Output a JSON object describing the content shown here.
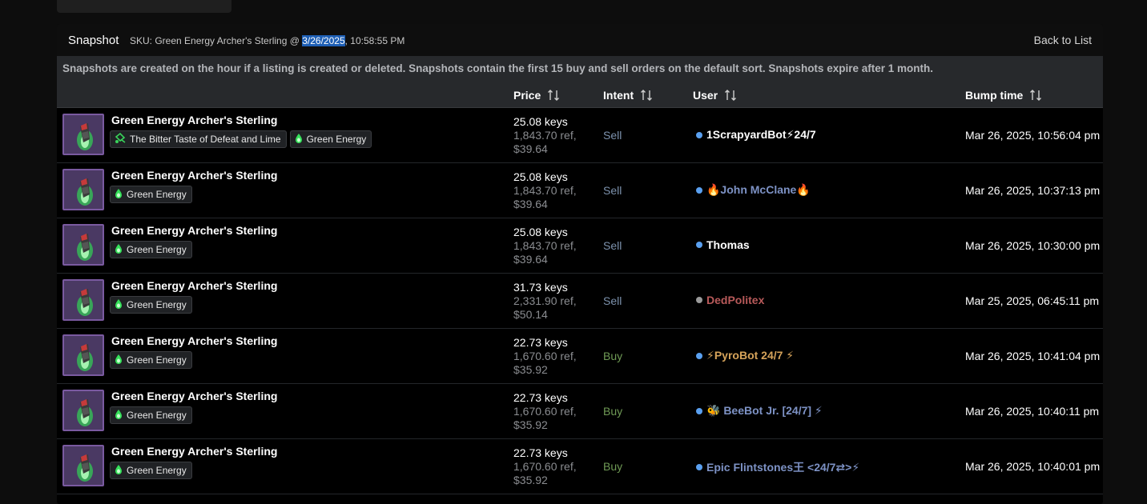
{
  "header": {
    "title": "Snapshot",
    "sku_prefix": "SKU: Green Energy Archer's Sterling @ ",
    "sku_date": "3/26/2025",
    "sku_time": ", 10:58:55 PM",
    "back_label": "Back to List"
  },
  "notice": "Snapshots are created on the hour if a listing is created or deleted. Snapshots contain the first 15 buy and sell orders on the default sort. Snapshots expire after 1 month.",
  "columns": {
    "price": "Price",
    "intent": "Intent",
    "user": "User",
    "bump": "Bump time"
  },
  "colors": {
    "sell": "#7d92ad",
    "buy": "#6f9a55",
    "online_dot": "#5aa0f0",
    "offline_dot": "#9a9a9a",
    "thumb_border": "#7a5aa0",
    "unusual_green": "#35e05a"
  },
  "rows": [
    {
      "name": "Green Energy Archer's Sterling",
      "tags": [
        {
          "icon": "paint-can-icon",
          "label": "The Bitter Taste of Defeat and Lime"
        },
        {
          "icon": "energy-drop-icon",
          "label": "Green Energy"
        }
      ],
      "price_keys": "25.08 keys",
      "price_ref": "1,843.70 ref,",
      "price_usd": "$39.64",
      "intent": "Sell",
      "intent_type": "sell",
      "user": "1ScrapyardBot⚡24/7",
      "user_color": "#ffffff",
      "dot": "#5aa0f0",
      "bump": "Mar 26, 2025, 10:56:04 pm"
    },
    {
      "name": "Green Energy Archer's Sterling",
      "tags": [
        {
          "icon": "energy-drop-icon",
          "label": "Green Energy"
        }
      ],
      "price_keys": "25.08 keys",
      "price_ref": "1,843.70 ref,",
      "price_usd": "$39.64",
      "intent": "Sell",
      "intent_type": "sell",
      "user": "🔥John McClane🔥",
      "user_color": "#7d92c5",
      "dot": "#5aa0f0",
      "bump": "Mar 26, 2025, 10:37:13 pm"
    },
    {
      "name": "Green Energy Archer's Sterling",
      "tags": [
        {
          "icon": "energy-drop-icon",
          "label": "Green Energy"
        }
      ],
      "price_keys": "25.08 keys",
      "price_ref": "1,843.70 ref,",
      "price_usd": "$39.64",
      "intent": "Sell",
      "intent_type": "sell",
      "user": "Thomas",
      "user_color": "#ffffff",
      "dot": "#5aa0f0",
      "bump": "Mar 26, 2025, 10:30:00 pm"
    },
    {
      "name": "Green Energy Archer's Sterling",
      "tags": [
        {
          "icon": "energy-drop-icon",
          "label": "Green Energy"
        }
      ],
      "price_keys": "31.73 keys",
      "price_ref": "2,331.90 ref,",
      "price_usd": "$50.14",
      "intent": "Sell",
      "intent_type": "sell",
      "user": "DedPolitex",
      "user_color": "#b85a5a",
      "dot": "#9a9a9a",
      "bump": "Mar 25, 2025, 06:45:11 pm"
    },
    {
      "name": "Green Energy Archer's Sterling",
      "tags": [
        {
          "icon": "energy-drop-icon",
          "label": "Green Energy"
        }
      ],
      "price_keys": "22.73 keys",
      "price_ref": "1,670.60 ref,",
      "price_usd": "$35.92",
      "intent": "Buy",
      "intent_type": "buy",
      "user": "⚡PyroBot 24/7 ⚡",
      "user_color": "#d6a35a",
      "dot": "#5aa0f0",
      "bump": "Mar 26, 2025, 10:41:04 pm"
    },
    {
      "name": "Green Energy Archer's Sterling",
      "tags": [
        {
          "icon": "energy-drop-icon",
          "label": "Green Energy"
        }
      ],
      "price_keys": "22.73 keys",
      "price_ref": "1,670.60 ref,",
      "price_usd": "$35.92",
      "intent": "Buy",
      "intent_type": "buy",
      "user": "🐝 BeeBot Jr. [24/7] ⚡",
      "user_color": "#7d92c5",
      "dot": "#5aa0f0",
      "bump": "Mar 26, 2025, 10:40:11 pm"
    },
    {
      "name": "Green Energy Archer's Sterling",
      "tags": [
        {
          "icon": "energy-drop-icon",
          "label": "Green Energy"
        }
      ],
      "price_keys": "22.73 keys",
      "price_ref": "1,670.60 ref,",
      "price_usd": "$35.92",
      "intent": "Buy",
      "intent_type": "buy",
      "user": "Epic Flintstones王 <24/7⇄>⚡",
      "user_color": "#7d92c5",
      "dot": "#5aa0f0",
      "bump": "Mar 26, 2025, 10:40:01 pm"
    }
  ]
}
